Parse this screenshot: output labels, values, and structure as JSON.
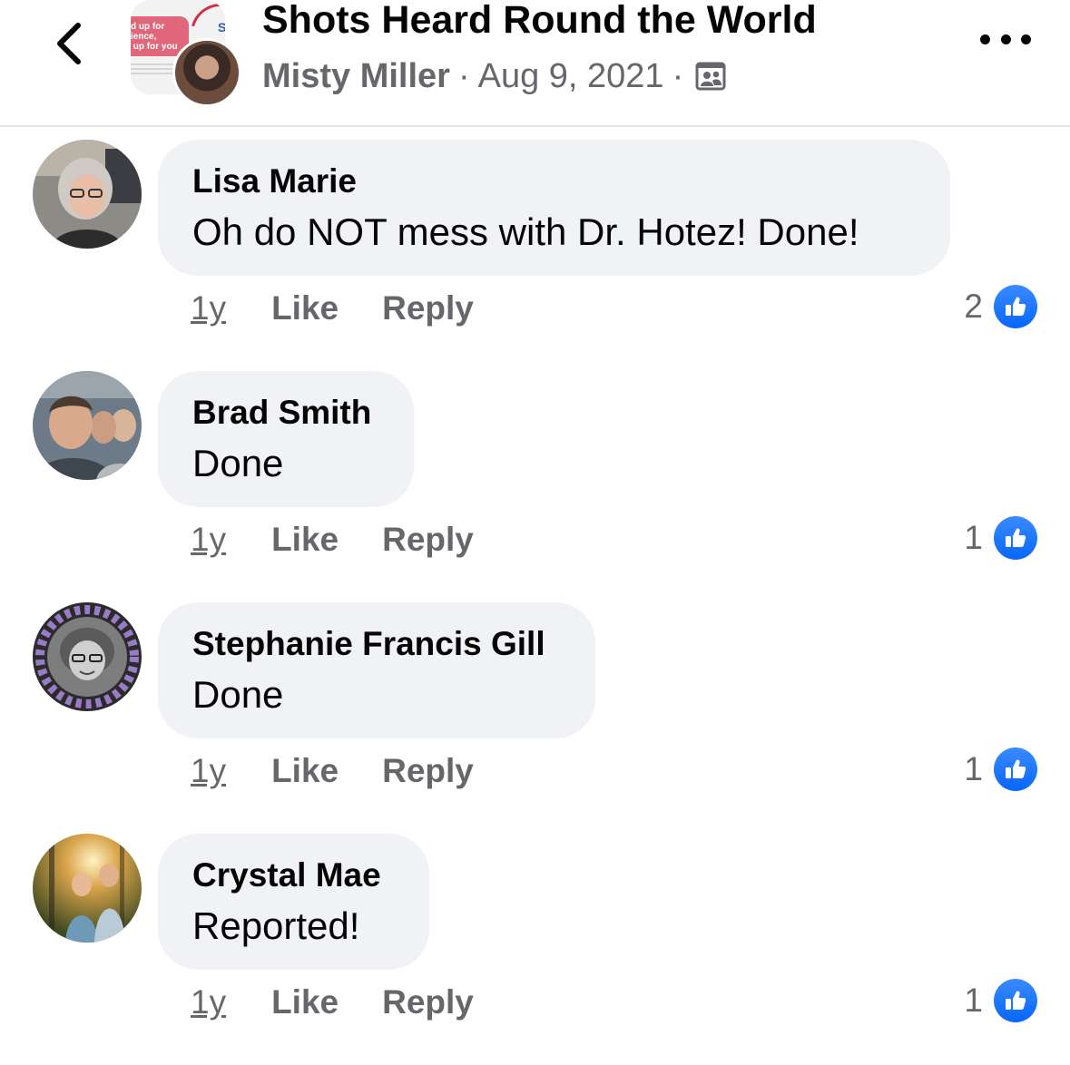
{
  "header": {
    "group_name": "Shots Heard Round the World",
    "author": "Misty Miller",
    "separator": "·",
    "date": "Aug 9, 2021",
    "thumb_text_1": "d up for\nience,\n up for you",
    "thumb_text_2": "Sh",
    "icons": {
      "back": "chevron-left-icon",
      "more": "more-dots-icon",
      "audience": "group-members-icon"
    }
  },
  "colors": {
    "bubble": "#f0f2f5",
    "meta_text": "#65676b",
    "like_blue": "#0866ff"
  },
  "comments": [
    {
      "name": "Lisa Marie",
      "text": "Oh do NOT mess with Dr. Hotez! Done!",
      "time": "1y",
      "like": "Like",
      "reply": "Reply",
      "reactions": "2"
    },
    {
      "name": "Brad Smith",
      "text": "Done",
      "time": "1y",
      "like": "Like",
      "reply": "Reply",
      "reactions": "1"
    },
    {
      "name": "Stephanie Francis Gill",
      "text": "Done",
      "time": "1y",
      "like": "Like",
      "reply": "Reply",
      "reactions": "1"
    },
    {
      "name": "Crystal Mae",
      "text": "Reported!",
      "time": "1y",
      "like": "Like",
      "reply": "Reply",
      "reactions": "1"
    }
  ]
}
